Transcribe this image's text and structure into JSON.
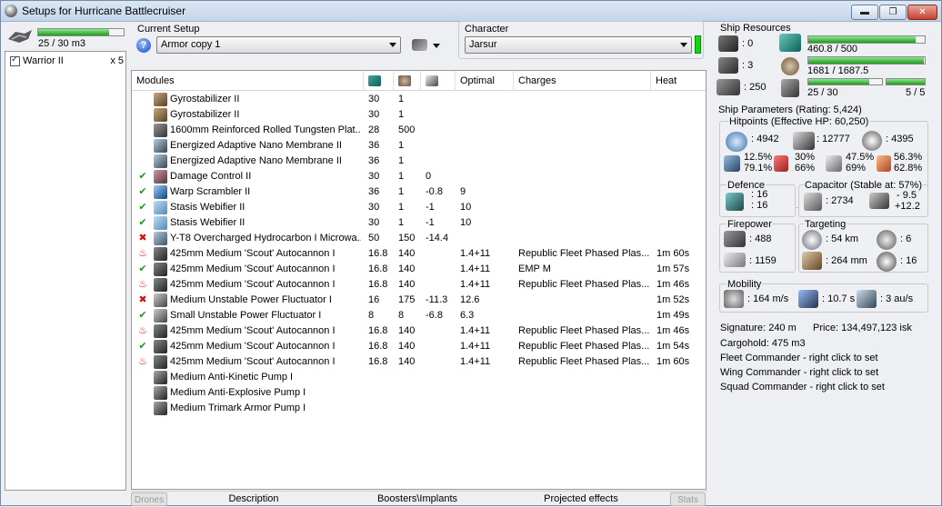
{
  "window": {
    "title": "Setups for Hurricane Battlecruiser",
    "controls": {
      "minimize": "▬",
      "maximize": "❐",
      "close": "✕"
    }
  },
  "drones": {
    "bandwidth_text": "25 / 30 m3",
    "bandwidth_fraction": 0.83,
    "items": [
      {
        "name": "Warrior II",
        "qty": "x 5",
        "checked": true
      }
    ]
  },
  "setup": {
    "label": "Current Setup",
    "help": "?",
    "selected": "Armor copy 1"
  },
  "character": {
    "label": "Character",
    "selected": "Jarsur",
    "status_color": "#17d417"
  },
  "modules": {
    "headers": [
      "Modules",
      "",
      "",
      "",
      "Optimal",
      "Charges",
      "Heat"
    ],
    "header_icons": [
      "cpu-icon",
      "powergrid-icon",
      "capacitor-icon"
    ],
    "rows": [
      {
        "status": "",
        "icon": "gyrostabilizer-icon",
        "name": "Gyrostabilizer II",
        "c1": "30",
        "c2": "1",
        "c3": "",
        "opt": "",
        "charge": "",
        "heat": ""
      },
      {
        "status": "",
        "icon": "gyrostabilizer-icon",
        "name": "Gyrostabilizer II",
        "c1": "30",
        "c2": "1",
        "c3": "",
        "opt": "",
        "charge": "",
        "heat": ""
      },
      {
        "status": "",
        "icon": "armor-plate-icon",
        "name": "1600mm Reinforced Rolled Tungsten Plat...",
        "c1": "28",
        "c2": "500",
        "c3": "",
        "opt": "",
        "charge": "",
        "heat": ""
      },
      {
        "status": "",
        "icon": "membrane-icon",
        "name": "Energized Adaptive Nano Membrane II",
        "c1": "36",
        "c2": "1",
        "c3": "",
        "opt": "",
        "charge": "",
        "heat": ""
      },
      {
        "status": "",
        "icon": "membrane-icon",
        "name": "Energized Adaptive Nano Membrane II",
        "c1": "36",
        "c2": "1",
        "c3": "",
        "opt": "",
        "charge": "",
        "heat": ""
      },
      {
        "status": "online",
        "icon": "damage-control-icon",
        "name": "Damage Control II",
        "c1": "30",
        "c2": "1",
        "c3": "0",
        "opt": "",
        "charge": "",
        "heat": ""
      },
      {
        "status": "online",
        "icon": "warp-scrambler-icon",
        "name": "Warp Scrambler II",
        "c1": "36",
        "c2": "1",
        "c3": "-0.8",
        "opt": "9",
        "charge": "",
        "heat": ""
      },
      {
        "status": "online",
        "icon": "stasis-webifier-icon",
        "name": "Stasis Webifier II",
        "c1": "30",
        "c2": "1",
        "c3": "-1",
        "opt": "10",
        "charge": "",
        "heat": ""
      },
      {
        "status": "online",
        "icon": "stasis-webifier-icon",
        "name": "Stasis Webifier II",
        "c1": "30",
        "c2": "1",
        "c3": "-1",
        "opt": "10",
        "charge": "",
        "heat": ""
      },
      {
        "status": "offline",
        "icon": "microwarpdrive-icon",
        "name": "Y-T8 Overcharged Hydrocarbon I Microwa...",
        "c1": "50",
        "c2": "150",
        "c3": "-14.4",
        "opt": "",
        "charge": "",
        "heat": ""
      },
      {
        "status": "overheat",
        "icon": "autocannon-icon",
        "name": "425mm Medium 'Scout' Autocannon I",
        "c1": "16.8",
        "c2": "140",
        "c3": "",
        "opt": "1.4+11",
        "charge": "Republic Fleet Phased Plas...",
        "heat": "1m 60s"
      },
      {
        "status": "online",
        "icon": "autocannon-icon",
        "name": "425mm Medium 'Scout' Autocannon I",
        "c1": "16.8",
        "c2": "140",
        "c3": "",
        "opt": "1.4+11",
        "charge": "EMP M",
        "heat": "1m 57s"
      },
      {
        "status": "overheat",
        "icon": "autocannon-icon",
        "name": "425mm Medium 'Scout' Autocannon I",
        "c1": "16.8",
        "c2": "140",
        "c3": "",
        "opt": "1.4+11",
        "charge": "Republic Fleet Phased Plas...",
        "heat": "1m 46s"
      },
      {
        "status": "offline",
        "icon": "power-fluctuator-icon",
        "name": "Medium Unstable Power Fluctuator I",
        "c1": "16",
        "c2": "175",
        "c3": "-11.3",
        "opt": "12.6",
        "charge": "",
        "heat": "1m 52s"
      },
      {
        "status": "online",
        "icon": "power-fluctuator-icon",
        "name": "Small Unstable Power Fluctuator I",
        "c1": "8",
        "c2": "8",
        "c3": "-6.8",
        "opt": "6.3",
        "charge": "",
        "heat": "1m 49s"
      },
      {
        "status": "overheat",
        "icon": "autocannon-icon",
        "name": "425mm Medium 'Scout' Autocannon I",
        "c1": "16.8",
        "c2": "140",
        "c3": "",
        "opt": "1.4+11",
        "charge": "Republic Fleet Phased Plas...",
        "heat": "1m 46s"
      },
      {
        "status": "online",
        "icon": "autocannon-icon",
        "name": "425mm Medium 'Scout' Autocannon I",
        "c1": "16.8",
        "c2": "140",
        "c3": "",
        "opt": "1.4+11",
        "charge": "Republic Fleet Phased Plas...",
        "heat": "1m 54s"
      },
      {
        "status": "overheat",
        "icon": "autocannon-icon",
        "name": "425mm Medium 'Scout' Autocannon I",
        "c1": "16.8",
        "c2": "140",
        "c3": "",
        "opt": "1.4+11",
        "charge": "Republic Fleet Phased Plas...",
        "heat": "1m 60s"
      },
      {
        "status": "",
        "icon": "rig-icon",
        "name": "Medium Anti-Kinetic Pump I",
        "c1": "",
        "c2": "",
        "c3": "",
        "opt": "",
        "charge": "",
        "heat": ""
      },
      {
        "status": "",
        "icon": "rig-icon",
        "name": "Medium Anti-Explosive Pump I",
        "c1": "",
        "c2": "",
        "c3": "",
        "opt": "",
        "charge": "",
        "heat": ""
      },
      {
        "status": "",
        "icon": "rig-icon",
        "name": "Medium Trimark Armor Pump I",
        "c1": "",
        "c2": "",
        "c3": "",
        "opt": "",
        "charge": "",
        "heat": ""
      }
    ]
  },
  "tabs": [
    "Drones",
    "Description",
    "Boosters\\Implants",
    "Projected effects",
    "Stats"
  ],
  "resources": {
    "title": "Ship Resources",
    "turret": ": 0",
    "launcher": ": 3",
    "calibration": ": 250",
    "cpu_text": "460.8 / 500",
    "cpu_fraction": 0.92,
    "power_text": "1681 / 1687.5",
    "power_fraction": 0.996,
    "drone_bw_text": "25 / 30",
    "drone_bw_fraction": 0.83,
    "drone_count": "5 / 5",
    "drone_count_fraction": 1.0
  },
  "params": {
    "title": "Ship Parameters (Rating: 5,424)",
    "hp_title": "Hitpoints (Effective HP: 60,250)",
    "shield_hp": ": 4942",
    "armor_hp": ": 12777",
    "structure_hp": ": 4395",
    "resists": {
      "em_a": "12.5%",
      "em_b": "79.1%",
      "therm_a": "30%",
      "therm_b": "66%",
      "kin_a": "47.5%",
      "kin_b": "69%",
      "exp_a": "56.3%",
      "exp_b": "62.8%"
    },
    "defence_title": "Defence",
    "defence_a": ": 16",
    "defence_b": ": 16",
    "cap_title": "Capacitor (Stable at: 57%)",
    "cap_amount": ": 2734",
    "cap_delta_a": "- 9.5",
    "cap_delta_b": "+12.2",
    "firepower_title": "Firepower",
    "dps": ": 488",
    "volley": ": 1159",
    "targeting_title": "Targeting",
    "range": ": 54 km",
    "max_targets": ": 6",
    "scan_res": ": 264 mm",
    "sensor_strength": ": 16",
    "mobility_title": "Mobility",
    "speed": ": 164 m/s",
    "align": ": 10.7 s",
    "warp": ": 3 au/s",
    "signature": "Signature: 240 m",
    "price": "Price: 134,497,123 isk",
    "cargo": "Cargohold: 475 m3",
    "fleet": "Fleet Commander - right click to set",
    "wing": "Wing Commander - right click to set",
    "squad": "Squad Commander - right click to set"
  },
  "colors": {
    "bar_green": "#1f9a1f",
    "online": "#1a9a1a",
    "offline": "#d41010"
  }
}
